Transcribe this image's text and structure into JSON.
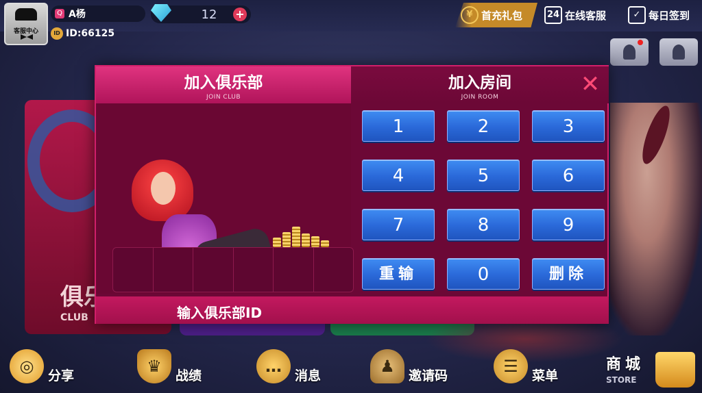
{
  "header": {
    "avatar_label": "客服中心",
    "username": "A杨",
    "user_id": "ID:66125",
    "gems": "12",
    "gem_plus": "+",
    "first_charge": "首充礼包",
    "online_service": "在线客服",
    "daily_signin": "每日签到",
    "service_icon_text": "24"
  },
  "background": {
    "club_card_title": "俱乐",
    "club_card_sub": "CLUB"
  },
  "dialog": {
    "tab_join_club": "加入俱乐部",
    "tab_join_club_en": "JOIN CLUB",
    "tab_join_room": "加入房间",
    "tab_join_room_en": "JOIN ROOM",
    "close_symbol": "✕",
    "hint": "输入俱乐部ID",
    "keys": [
      "1",
      "2",
      "3",
      "4",
      "5",
      "6",
      "7",
      "8",
      "9",
      "重输",
      "0",
      "删除"
    ]
  },
  "bottom_nav": {
    "share": "分享",
    "record": "战绩",
    "message": "消息",
    "invite": "邀请码",
    "menu": "菜单",
    "store": "商城",
    "store_en": "STORE"
  }
}
